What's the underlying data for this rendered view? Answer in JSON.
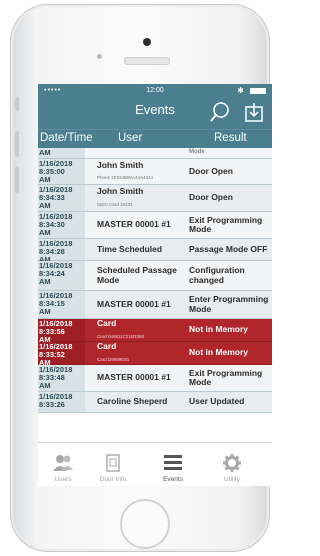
{
  "status_bar": {
    "signal": "•••••",
    "time": "12:00",
    "bluetooth": "✱"
  },
  "header": {
    "title": "Events"
  },
  "columns": {
    "datetime": "Date/Time",
    "user": "User",
    "result": "Result"
  },
  "partial_top": {
    "datetime": "AM",
    "result": "Mode"
  },
  "rows": [
    {
      "datetime": [
        "1/16/2018",
        "8:35:00",
        "AM"
      ],
      "user": "John Smith",
      "detail": "Phone 2F834B90A44A4344",
      "result": [
        "Door Open"
      ],
      "style": "plain"
    },
    {
      "datetime": [
        "1/16/2018",
        "8:34:33",
        "AM"
      ],
      "user": "John Smith",
      "detail": "ISEO Card 18431",
      "result": [
        "Door Open"
      ],
      "style": "alt"
    },
    {
      "datetime": [
        "1/16/2018",
        "8:34:30",
        "AM"
      ],
      "user": "MASTER 00001 #1",
      "detail": "",
      "result": [
        "Exit Programming",
        "Mode"
      ],
      "style": "plain"
    },
    {
      "datetime": [
        "1/16/2018",
        "8:34:28",
        "AM"
      ],
      "user": "Time Scheduled",
      "detail": "",
      "result": [
        "Passage Mode OFF"
      ],
      "style": "alt"
    },
    {
      "datetime": [
        "1/16/2018",
        "8:34:24",
        "AM"
      ],
      "user": "Scheduled Passage Mode",
      "detail": "",
      "result": [
        "Configuration",
        "changed"
      ],
      "style": "plain"
    },
    {
      "datetime": [
        "1/16/2018",
        "8:34:15",
        "AM"
      ],
      "user": "MASTER 00001 #1",
      "detail": "",
      "result": [
        "Enter Programming",
        "Mode"
      ],
      "style": "alt"
    },
    {
      "datetime": [
        "1/16/2018",
        "8:33:56",
        "AM"
      ],
      "user": "Card",
      "detail": "Card 046511C21B3380",
      "result": [
        "Not in Memory"
      ],
      "style": "red"
    },
    {
      "datetime": [
        "1/16/2018",
        "8:33:52",
        "AM"
      ],
      "user": "Card",
      "detail": "Card D9689E81",
      "result": [
        "Not in Memory"
      ],
      "style": "red"
    },
    {
      "datetime": [
        "1/16/2018",
        "8:33:48",
        "AM"
      ],
      "user": "MASTER 00001 #1",
      "detail": "",
      "result": [
        "Exit Programming",
        "Mode"
      ],
      "style": "plain"
    },
    {
      "datetime": [
        "1/16/2018",
        "8:33:26"
      ],
      "user": "Caroline Sheperd",
      "detail": "",
      "result": [
        "User Updated"
      ],
      "style": "alt"
    }
  ],
  "tabs": [
    {
      "label": "Users",
      "icon": "users-icon"
    },
    {
      "label": "Door Info",
      "icon": "door-info-icon"
    },
    {
      "label": "Events",
      "icon": "events-list-icon",
      "active": true
    },
    {
      "label": "Utility",
      "icon": "gear-icon"
    }
  ],
  "colors": {
    "header": "#4b7e8f",
    "alert_row": "#b0262b",
    "datetime_cell": "#d7e3e7"
  }
}
